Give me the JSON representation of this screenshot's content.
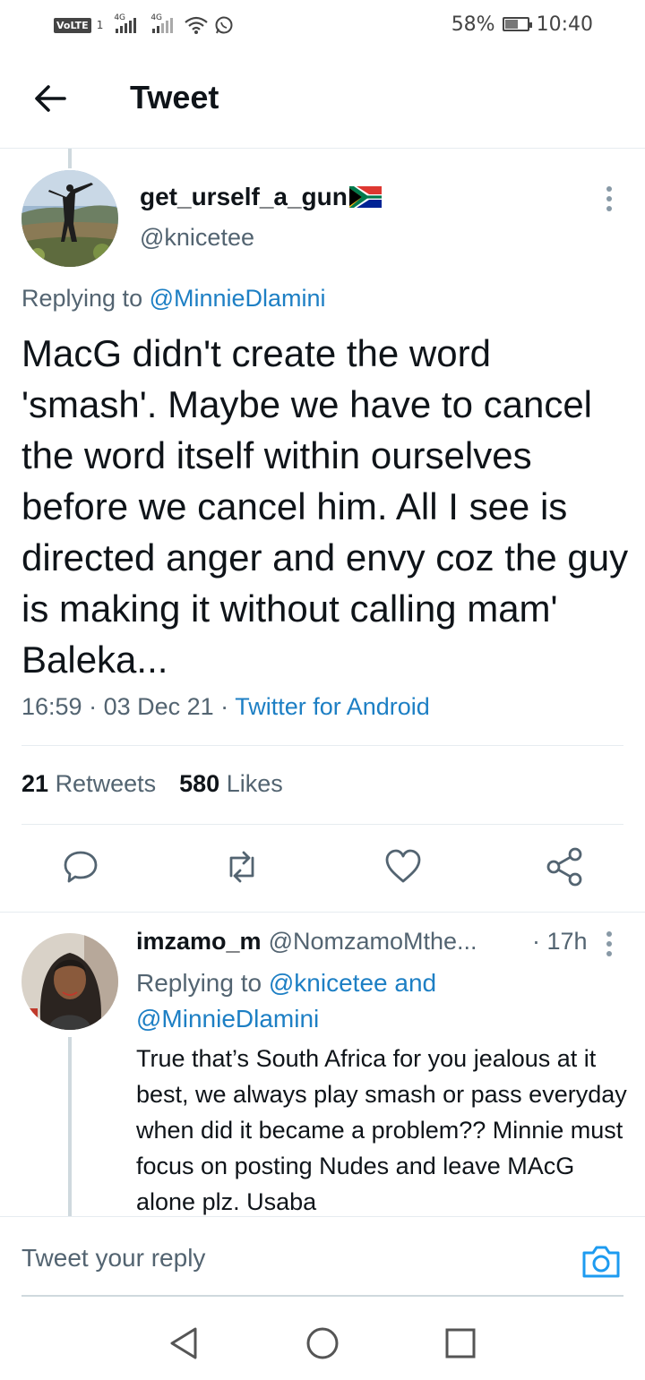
{
  "status_bar": {
    "volte": "VoLTE",
    "sim": "1",
    "net1": "4G",
    "net2": "4G",
    "battery_percent": "58%",
    "battery_level": 0.58,
    "time": "10:40"
  },
  "header": {
    "title": "Tweet"
  },
  "main_tweet": {
    "display_name": "get_urself_a_gun",
    "handle": "@knicetee",
    "replying_prefix": "Replying to ",
    "replying_to": "@MinnieDlamini",
    "text": "MacG didn't create the word 'smash'. Maybe we have to cancel the word itself within ourselves before we cancel him. All I see is directed anger and envy coz the guy is making it without calling mam' Baleka...",
    "time": "16:59",
    "sep": " · ",
    "date": "03 Dec 21",
    "source": "Twitter for Android",
    "retweets_count": "21",
    "retweets_label": "Retweets",
    "likes_count": "580",
    "likes_label": "Likes"
  },
  "reply_tweet": {
    "display_name": "imzamo_m",
    "handle": "@NomzamoMthe...",
    "time": "· 17h",
    "replying_prefix": "Replying to ",
    "replying_to_1": "@knicetee",
    "replying_and": " and",
    "replying_to_2": "@MinnieDlamini",
    "text": "True that’s South Africa for you jealous at it best, we always play smash or pass everyday when did it became a problem?? Minnie must focus on posting Nudes and leave MAcG alone plz. Usaba"
  },
  "composer": {
    "placeholder": "Tweet your reply"
  },
  "icons": {
    "back": "arrow-left-icon",
    "more": "more-vertical-icon",
    "reply": "comment-icon",
    "retweet": "retweet-icon",
    "like": "heart-icon",
    "share": "share-icon",
    "camera": "camera-icon",
    "nav_back": "triangle-back-icon",
    "nav_home": "circle-home-icon",
    "nav_recent": "square-recent-icon"
  },
  "colors": {
    "link": "#1d7fc4",
    "secondary_text": "#536471",
    "divider": "#e6ecf0"
  }
}
